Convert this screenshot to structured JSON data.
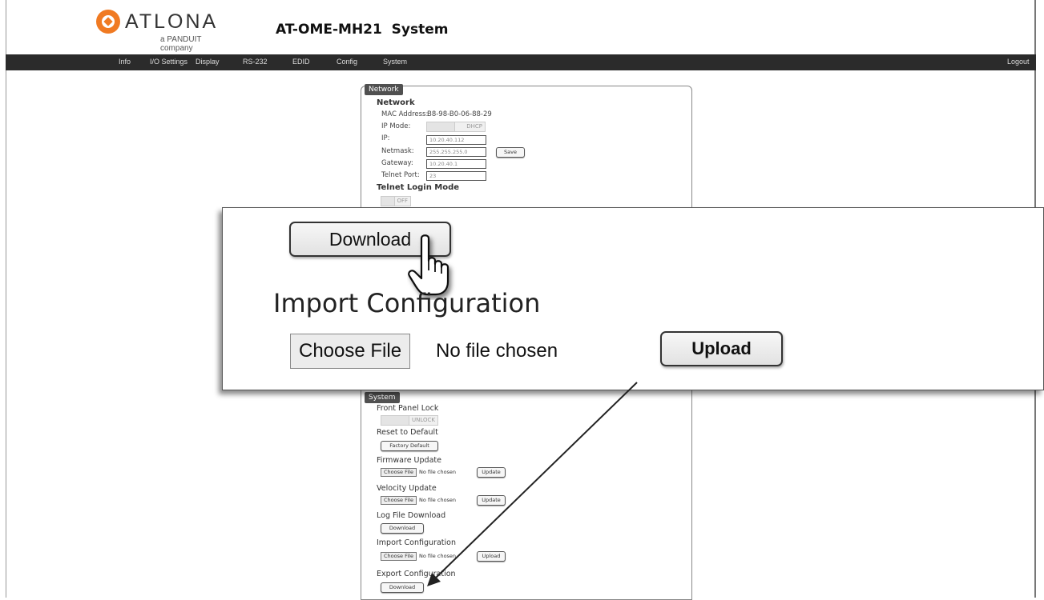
{
  "header": {
    "logo_text": "ATLONA",
    "logo_sub": "a PANDUIT company",
    "title": "AT-OME-MH21  System"
  },
  "nav": {
    "items": [
      "Info",
      "I/O Settings",
      "Display",
      "RS-232",
      "EDID",
      "Config",
      "System"
    ],
    "logout": "Logout"
  },
  "network_panel": {
    "tab": "Network",
    "title": "Network",
    "mac_label": "MAC Address:",
    "mac_value": "B8-98-B0-06-88-29",
    "ip_mode_label": "IP Mode:",
    "ip_mode_value": "DHCP",
    "ip_label": "IP:",
    "ip_value": "10.20.40.112",
    "netmask_label": "Netmask:",
    "netmask_value": "255.255.255.0",
    "gateway_label": "Gateway:",
    "gateway_value": "10.20.40.1",
    "telnet_port_label": "Telnet Port:",
    "telnet_port_value": "23",
    "save_label": "Save",
    "telnet_login_title": "Telnet Login Mode",
    "telnet_login_value": "OFF"
  },
  "zoom": {
    "download_label": "Download",
    "import_heading": "Import Configuration",
    "choose_label": "Choose File",
    "no_file": "No file chosen",
    "upload_label": "Upload"
  },
  "system_panel": {
    "tab": "System",
    "front_panel_title": "Front Panel Lock",
    "front_panel_value": "UNLOCK",
    "reset_title": "Reset to Default",
    "factory_label": "Factory Default",
    "firmware_title": "Firmware Update",
    "velocity_title": "Velocity Update",
    "choose_label": "Choose File",
    "no_file": "No file chosen",
    "update_label": "Update",
    "log_title": "Log File Download",
    "download_label": "Download",
    "import_title": "Import Configuration",
    "upload_label": "Upload",
    "export_title": "Export Configuration"
  }
}
